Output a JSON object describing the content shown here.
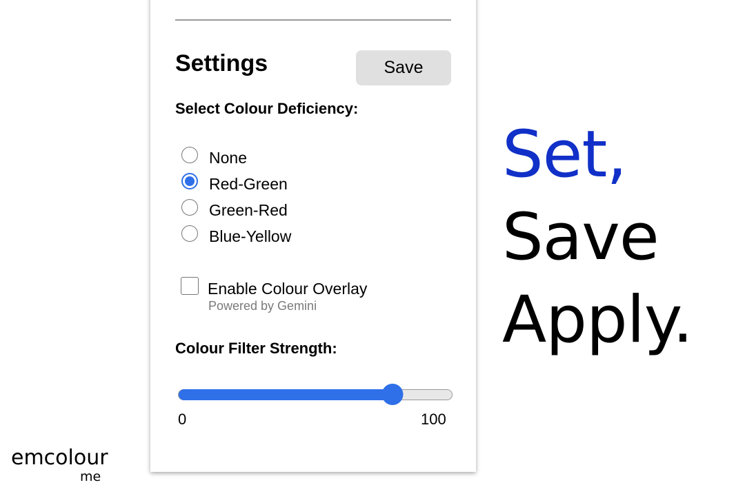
{
  "settings": {
    "title": "Settings",
    "save_label": "Save",
    "deficiency_label": "Select Colour Deficiency:",
    "options": [
      {
        "label": "None",
        "checked": false
      },
      {
        "label": "Red-Green",
        "checked": true
      },
      {
        "label": "Green-Red",
        "checked": false
      },
      {
        "label": "Blue-Yellow",
        "checked": false
      }
    ],
    "overlay": {
      "label": "Enable Colour Overlay",
      "checked": false,
      "powered_by": "Powered by Gemini"
    },
    "strength": {
      "label": "Colour Filter Strength:",
      "min_label": "0",
      "max_label": "100",
      "value": 78
    }
  },
  "tagline": {
    "line1": "Set,",
    "line2": "Save",
    "line3": "Apply."
  },
  "logo": {
    "main": "emcolour",
    "sub": "me"
  },
  "colors": {
    "accent": "#2f6fe8",
    "tagline_highlight": "#1030c8",
    "button_bg": "#e0e0e0"
  }
}
